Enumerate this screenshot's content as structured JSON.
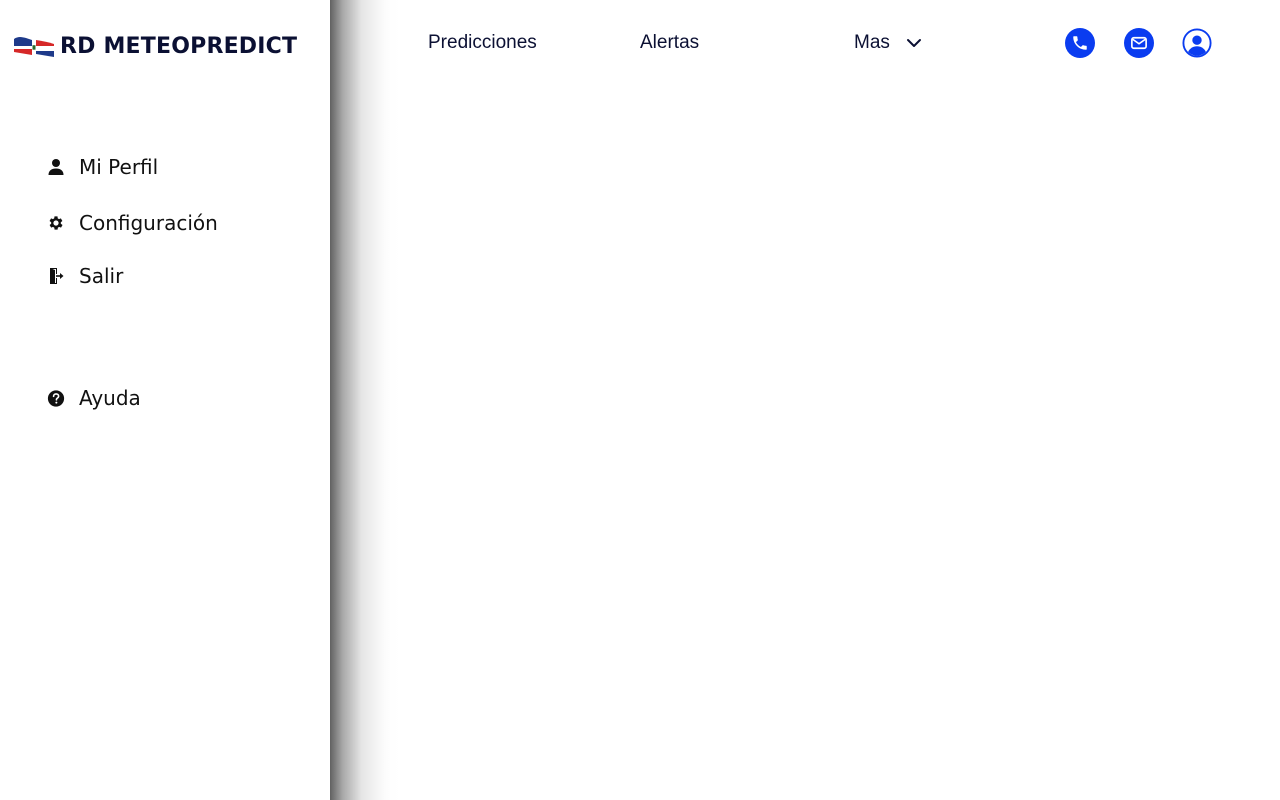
{
  "brand": {
    "name": "RD METEOPREDICT",
    "flag_colors": {
      "blue": "#1e3a8a",
      "red": "#d62828",
      "white": "#ffffff"
    }
  },
  "nav": {
    "items": [
      {
        "label": "Predicciones"
      },
      {
        "label": "Alertas"
      },
      {
        "label": "Mas"
      }
    ],
    "icons": [
      "phone-icon",
      "mail-icon",
      "user-profile-icon"
    ]
  },
  "sidebar": {
    "items": [
      {
        "label": "Mi Perfil",
        "icon": "user-icon"
      },
      {
        "label": "Configuración",
        "icon": "gear-icon"
      },
      {
        "label": "Salir",
        "icon": "logout-icon"
      },
      {
        "label": "Ayuda",
        "icon": "help-icon"
      }
    ]
  },
  "colors": {
    "accent": "#0a3cf0",
    "text_dark": "#0b1033",
    "background": "#ffffff"
  }
}
